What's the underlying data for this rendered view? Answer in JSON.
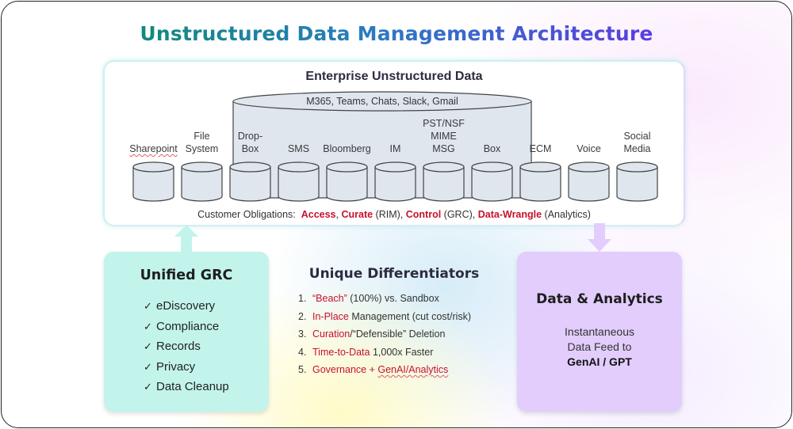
{
  "title": "Unstructured Data Management Architecture",
  "enterprise": {
    "title": "Enterprise Unstructured Data",
    "big_cylinder_label": "M365, Teams, Chats, Slack, Gmail",
    "stores": [
      {
        "line1": "",
        "line2": "",
        "line3": "Sharepoint"
      },
      {
        "line1": "",
        "line2": "File",
        "line3": "System"
      },
      {
        "line1": "",
        "line2": "Drop-",
        "line3": "Box"
      },
      {
        "line1": "",
        "line2": "",
        "line3": "SMS"
      },
      {
        "line1": "",
        "line2": "",
        "line3": "Bloomberg"
      },
      {
        "line1": "",
        "line2": "",
        "line3": "IM"
      },
      {
        "line1": "PST/NSF",
        "line2": "MIME",
        "line3": "MSG"
      },
      {
        "line1": "",
        "line2": "",
        "line3": "Box"
      },
      {
        "line1": "",
        "line2": "",
        "line3": "ECM"
      },
      {
        "line1": "",
        "line2": "",
        "line3": "Voice"
      },
      {
        "line1": "",
        "line2": "Social",
        "line3": "Media"
      }
    ],
    "obligations": {
      "prefix": "Customer Obligations:",
      "items": [
        {
          "key": "Access",
          "suffix": ","
        },
        {
          "key": "Curate",
          "suffix": " (RIM),"
        },
        {
          "key": "Control",
          "suffix": " (GRC),"
        },
        {
          "key": "Data-Wrangle",
          "suffix": " (Analytics)"
        }
      ]
    }
  },
  "grc": {
    "title": "Unified GRC",
    "check_icon": "✓",
    "items": [
      "eDiscovery",
      "Compliance",
      "Records",
      "Privacy",
      "Data Cleanup"
    ]
  },
  "differentiators": {
    "title": "Unique Differentiators",
    "items": [
      {
        "num": "1.",
        "red": "“Beach”",
        "rest": " (100%) vs. Sandbox",
        "red2": ""
      },
      {
        "num": "2.",
        "red": "In-Place",
        "rest": " Management (cut cost/risk)",
        "red2": ""
      },
      {
        "num": "3.",
        "red": "Curation",
        "rest": "/“Defensible” Deletion",
        "red2": ""
      },
      {
        "num": "4.",
        "red": "Time-to-Data",
        "rest": " 1,000x Faster",
        "red2": ""
      },
      {
        "num": "5.",
        "red": "Governance + ",
        "rest": "",
        "red2": "GenAI/Analytics"
      }
    ]
  },
  "analytics": {
    "title": "Data & Analytics",
    "line1": "Instantaneous",
    "line2": "Data Feed to",
    "line3": "GenAI / GPT"
  },
  "colors": {
    "accent_red": "#c8102e",
    "grc_bg": "#c2f4ec",
    "analytics_bg": "#e2cdfc",
    "cylinder_fill": "#dfe6ee"
  }
}
